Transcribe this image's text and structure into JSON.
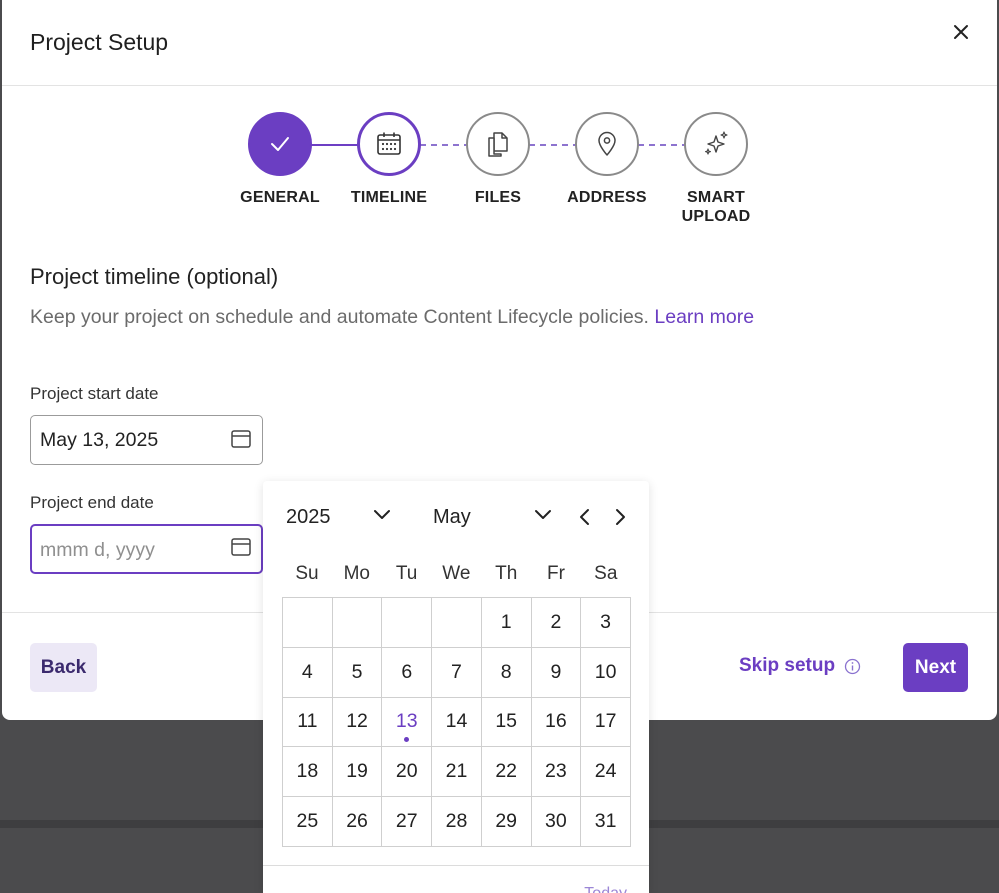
{
  "modal": {
    "title": "Project Setup",
    "accent_color": "#6b3ec2"
  },
  "stepper": {
    "steps": [
      {
        "label": "GENERAL",
        "state": "done",
        "icon": "check-icon"
      },
      {
        "label": "TIMELINE",
        "state": "active",
        "icon": "calendar-icon"
      },
      {
        "label": "FILES",
        "state": "pending",
        "icon": "files-icon"
      },
      {
        "label": "ADDRESS",
        "state": "pending",
        "icon": "location-pin-icon"
      },
      {
        "label": "SMART UPLOAD",
        "line1": "SMART",
        "line2": "UPLOAD",
        "state": "pending",
        "icon": "sparkle-icon"
      }
    ]
  },
  "content": {
    "title": "Project timeline (optional)",
    "description": "Keep your project on schedule and automate Content Lifecycle policies.",
    "learn_more": "Learn more"
  },
  "fields": {
    "start_label": "Project start date",
    "start_value": "May 13, 2025",
    "end_label": "Project end date",
    "end_placeholder": "mmm d, yyyy",
    "end_value": ""
  },
  "footer": {
    "back_label": "Back",
    "skip_label": "Skip setup",
    "next_label": "Next"
  },
  "calendar": {
    "year": "2025",
    "month": "May",
    "weekdays": [
      "Su",
      "Mo",
      "Tu",
      "We",
      "Th",
      "Fr",
      "Sa"
    ],
    "weeks": [
      [
        "",
        "",
        "",
        "",
        "1",
        "2",
        "3"
      ],
      [
        "4",
        "5",
        "6",
        "7",
        "8",
        "9",
        "10"
      ],
      [
        "11",
        "12",
        "13",
        "14",
        "15",
        "16",
        "17"
      ],
      [
        "18",
        "19",
        "20",
        "21",
        "22",
        "23",
        "24"
      ],
      [
        "25",
        "26",
        "27",
        "28",
        "29",
        "30",
        "31"
      ]
    ],
    "today_day": "13",
    "today_label": "Today"
  }
}
